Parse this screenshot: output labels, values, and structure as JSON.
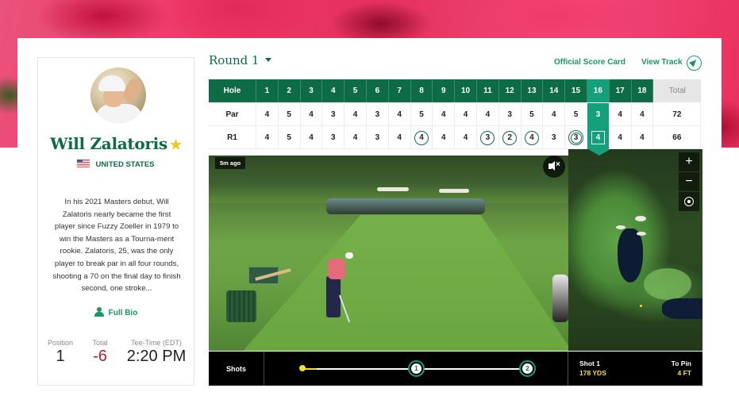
{
  "player": {
    "name": "Will Zalatoris",
    "favorite_icon": "star-icon",
    "country": "UNITED STATES",
    "country_flag": "us-flag-icon",
    "bio": "In his 2021 Masters debut, Will Zalatoris nearly became the first player since Fuzzy Zoeller in 1979 to win the Masters as a Tourna-ment rookie. Zalatoris, 25, was the only player to break par in all four rounds, shooting a 70 on the final day to finish second, one stroke...",
    "full_bio_label": "Full Bio",
    "stats": {
      "position_label": "Position",
      "position_value": "1",
      "total_label": "Total",
      "total_value": "-6",
      "tee_time_label": "Tee-Time (EDT)",
      "tee_time_value": "2:20 PM"
    }
  },
  "header": {
    "round_label": "Round 1",
    "official_score_card": "Official Score Card",
    "view_track": "View Track"
  },
  "scorecard": {
    "row_labels": [
      "Hole",
      "Par",
      "R1"
    ],
    "holes": [
      "1",
      "2",
      "3",
      "4",
      "5",
      "6",
      "7",
      "8",
      "9",
      "10",
      "11",
      "12",
      "13",
      "14",
      "15",
      "16",
      "17",
      "18"
    ],
    "total_label": "Total",
    "par": [
      "4",
      "5",
      "4",
      "3",
      "4",
      "3",
      "4",
      "5",
      "4",
      "4",
      "4",
      "3",
      "5",
      "4",
      "5",
      "3",
      "4",
      "4"
    ],
    "par_total": "72",
    "r1": [
      "4",
      "5",
      "4",
      "3",
      "4",
      "3",
      "4",
      "4",
      "4",
      "4",
      "3",
      "2",
      "4",
      "3",
      "3",
      "4",
      "4",
      "4"
    ],
    "r1_total": "66",
    "r1_marks": [
      "none",
      "none",
      "none",
      "none",
      "none",
      "none",
      "none",
      "birdie",
      "none",
      "none",
      "birdie",
      "birdie",
      "birdie",
      "none",
      "eagle",
      "current",
      "none",
      "none"
    ],
    "active_hole": "16"
  },
  "video": {
    "timestamp": "5m ago",
    "mute_icon": "mute-icon"
  },
  "map": {
    "zoom_in": "+",
    "zoom_out": "−"
  },
  "shots": {
    "label": "Shots",
    "markers": [
      "1",
      "2"
    ],
    "shot_name": "Shot 1",
    "shot_distance": "178 YDS",
    "to_pin_label": "To Pin",
    "to_pin_value": "4 FT"
  },
  "colors": {
    "brand_green": "#0d6b46",
    "active_teal": "#14a07a",
    "link_green": "#199666",
    "score_red": "#b0202c",
    "highlight_yellow": "#f5e020",
    "star_yellow": "#f2c615"
  }
}
